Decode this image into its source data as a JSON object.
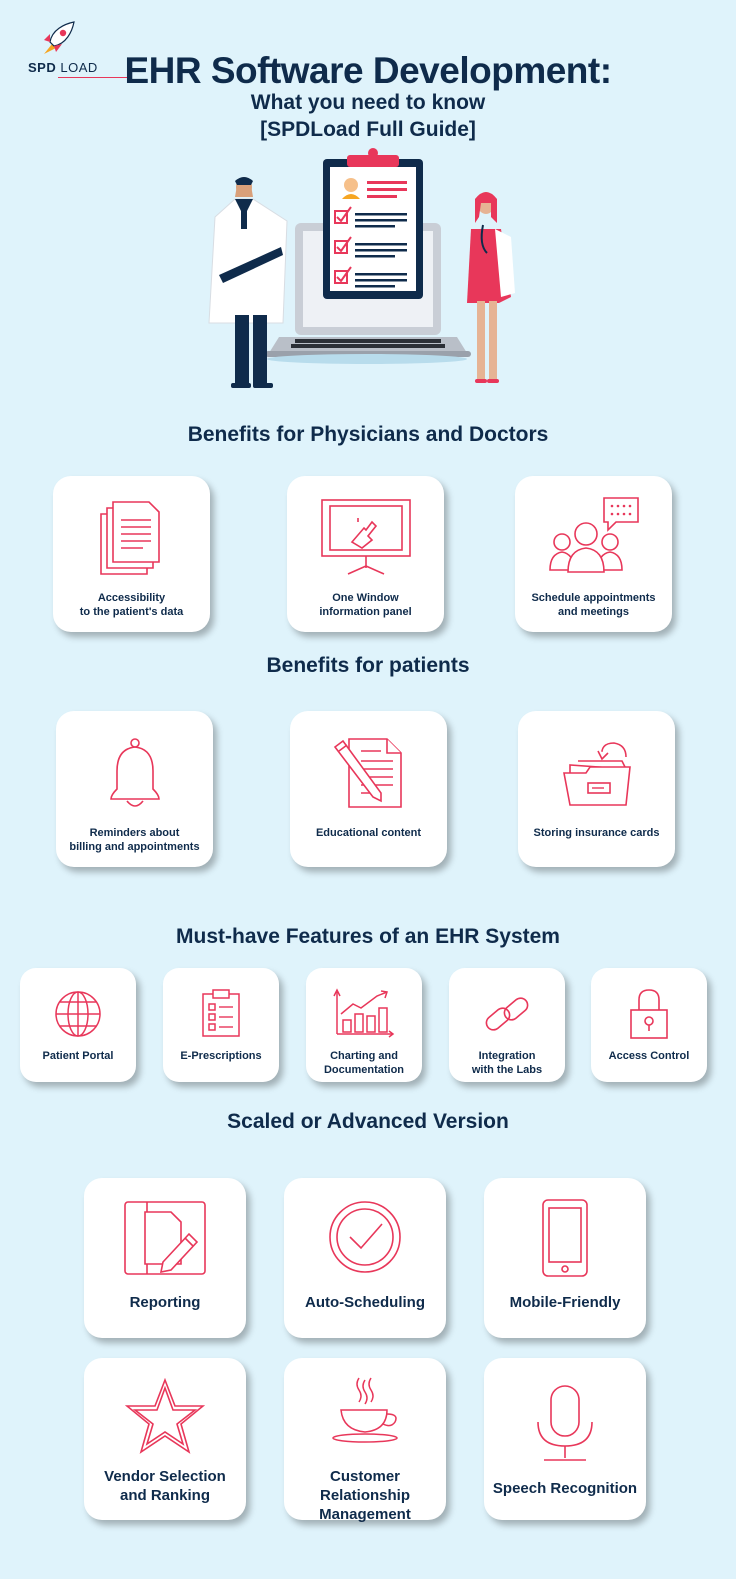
{
  "logo": {
    "brand_bold": "SPD",
    "brand_light": "LOAD"
  },
  "header": {
    "title": "EHR Software Development:",
    "subtitle_line1": "What you need to know",
    "subtitle_line2": "[SPDLoad Full Guide]"
  },
  "sections": {
    "physicians": {
      "title": "Benefits for Physicians and Doctors",
      "cards": [
        {
          "icon": "documents-icon",
          "line1": "Accessibility",
          "line2": "to the patient's data"
        },
        {
          "icon": "monitor-touch-icon",
          "line1": "One Window",
          "line2": "information panel"
        },
        {
          "icon": "group-chat-icon",
          "line1": "Schedule appointments",
          "line2": "and meetings"
        }
      ]
    },
    "patients": {
      "title": "Benefits for patients",
      "cards": [
        {
          "icon": "bell-icon",
          "line1": "Reminders about",
          "line2": "billing and appointments"
        },
        {
          "icon": "document-pencil-icon",
          "line1": "Educational content",
          "line2": ""
        },
        {
          "icon": "folder-card-icon",
          "line1": "Storing insurance cards",
          "line2": ""
        }
      ]
    },
    "features": {
      "title": "Must-have Features of an EHR System",
      "cards": [
        {
          "icon": "globe-icon",
          "line1": "Patient Portal",
          "line2": ""
        },
        {
          "icon": "clipboard-checklist-icon",
          "line1": "E-Prescriptions",
          "line2": ""
        },
        {
          "icon": "chart-growth-icon",
          "line1": "Charting and",
          "line2": "Documentation"
        },
        {
          "icon": "chain-link-icon",
          "line1": "Integration",
          "line2": "with the Labs"
        },
        {
          "icon": "padlock-icon",
          "line1": "Access Control",
          "line2": ""
        }
      ]
    },
    "advanced": {
      "title": "Scaled or Advanced Version",
      "cards": [
        {
          "icon": "report-pencil-icon",
          "line1": "Reporting",
          "line2": ""
        },
        {
          "icon": "circle-check-icon",
          "line1": "Auto-Scheduling",
          "line2": ""
        },
        {
          "icon": "smartphone-icon",
          "line1": "Mobile-Friendly",
          "line2": ""
        },
        {
          "icon": "star-icon",
          "line1": "Vendor Selection",
          "line2": "and Ranking"
        },
        {
          "icon": "coffee-cup-icon",
          "line1": "Customer Relationship",
          "line2": "Management"
        },
        {
          "icon": "microphone-icon",
          "line1": "Speech Recognition",
          "line2": ""
        }
      ]
    }
  },
  "colors": {
    "accent": "#e8375a",
    "navy": "#0f2b4b",
    "background": "#dff3fb"
  }
}
